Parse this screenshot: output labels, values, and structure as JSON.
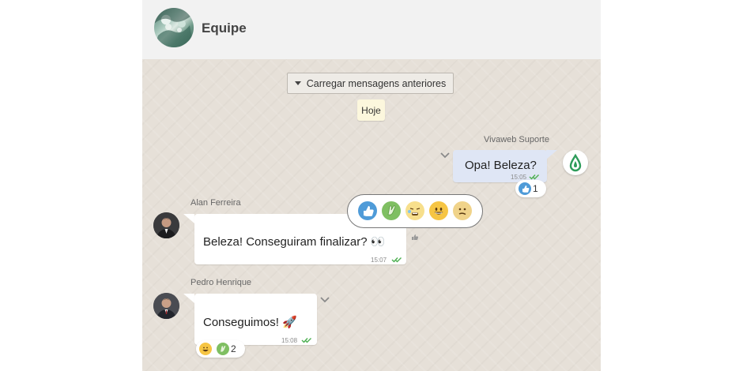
{
  "header": {
    "group_name": "Equipe"
  },
  "toolbar": {
    "load_more_label": "Carregar mensagens anteriores"
  },
  "day_label": "Hoje",
  "messages": [
    {
      "sender": "Vivaweb Suporte",
      "text": "Opa! Beleza?",
      "time": "15:05",
      "reactions": [
        {
          "icon": "thumbs-up",
          "count": "1"
        }
      ]
    },
    {
      "sender": "Alan Ferreira",
      "text": "Beleza! Conseguiram finalizar? 👀",
      "time": "15:07"
    },
    {
      "sender": "Pedro Henrique",
      "text": "Conseguimos! 🚀",
      "time": "15:08",
      "reactions": [
        {
          "icon": "grinning-face"
        },
        {
          "icon": "clapping-hands",
          "count": "2"
        }
      ]
    }
  ],
  "reaction_picker": [
    "thumbs-up",
    "clapping-hands",
    "tired-face",
    "grinning-face",
    "confused-face"
  ],
  "colors": {
    "accent_green": "#3aa66a",
    "tick_green": "#4caf50",
    "outgoing_bubble": "#dfe6f5",
    "chat_background": "#e6e0d8"
  }
}
